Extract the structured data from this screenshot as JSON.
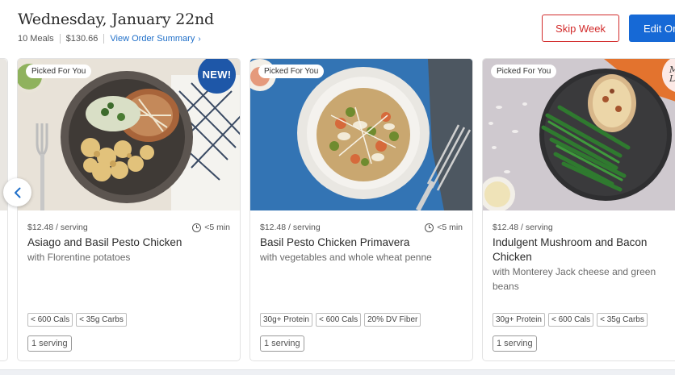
{
  "header": {
    "date_title": "Wednesday, January 22nd",
    "meals": "10 Meals",
    "total": "$130.66",
    "order_summary_link": "View Order Summary",
    "skip_week_label": "Skip Week",
    "edit_order_label": "Edit Or"
  },
  "carousel": {
    "prev_icon": "chevron-left-icon",
    "cards": [
      {
        "pill": "Picked For You",
        "badge": "NEW!",
        "price": "$12.48 / serving",
        "time": "<5 min",
        "title": "Asiago and Basil Pesto Chicken",
        "subtitle": "with Florentine potatoes",
        "tags": [
          "< 600 Cals",
          "< 35g Carbs"
        ],
        "serving": "1 serving"
      },
      {
        "pill": "Picked For You",
        "price": "$12.48 / serving",
        "time": "<5 min",
        "title": "Basil Pesto Chicken Primavera",
        "subtitle": "with vegetables and whole wheat penne",
        "tags": [
          "30g+ Protein",
          "< 600 Cals",
          "20% DV Fiber"
        ],
        "serving": "1 serving"
      },
      {
        "pill": "Picked For You",
        "badge_line1": "M",
        "badge_line2": "L",
        "price": "$12.48 / serving",
        "title_line1": "Indulgent Mushroom and Bacon",
        "title_line2": "Chicken",
        "subtitle_line1": "with Monterey Jack cheese and green",
        "subtitle_line2": "beans",
        "tags": [
          "30g+ Protein",
          "< 600 Cals",
          "< 35g Carbs"
        ],
        "serving": "1 serving"
      }
    ]
  },
  "colors": {
    "accent_blue": "#1669d6",
    "skip_red": "#d22b2b",
    "link_blue": "#1f6fc9",
    "new_badge": "#1e57a8"
  }
}
